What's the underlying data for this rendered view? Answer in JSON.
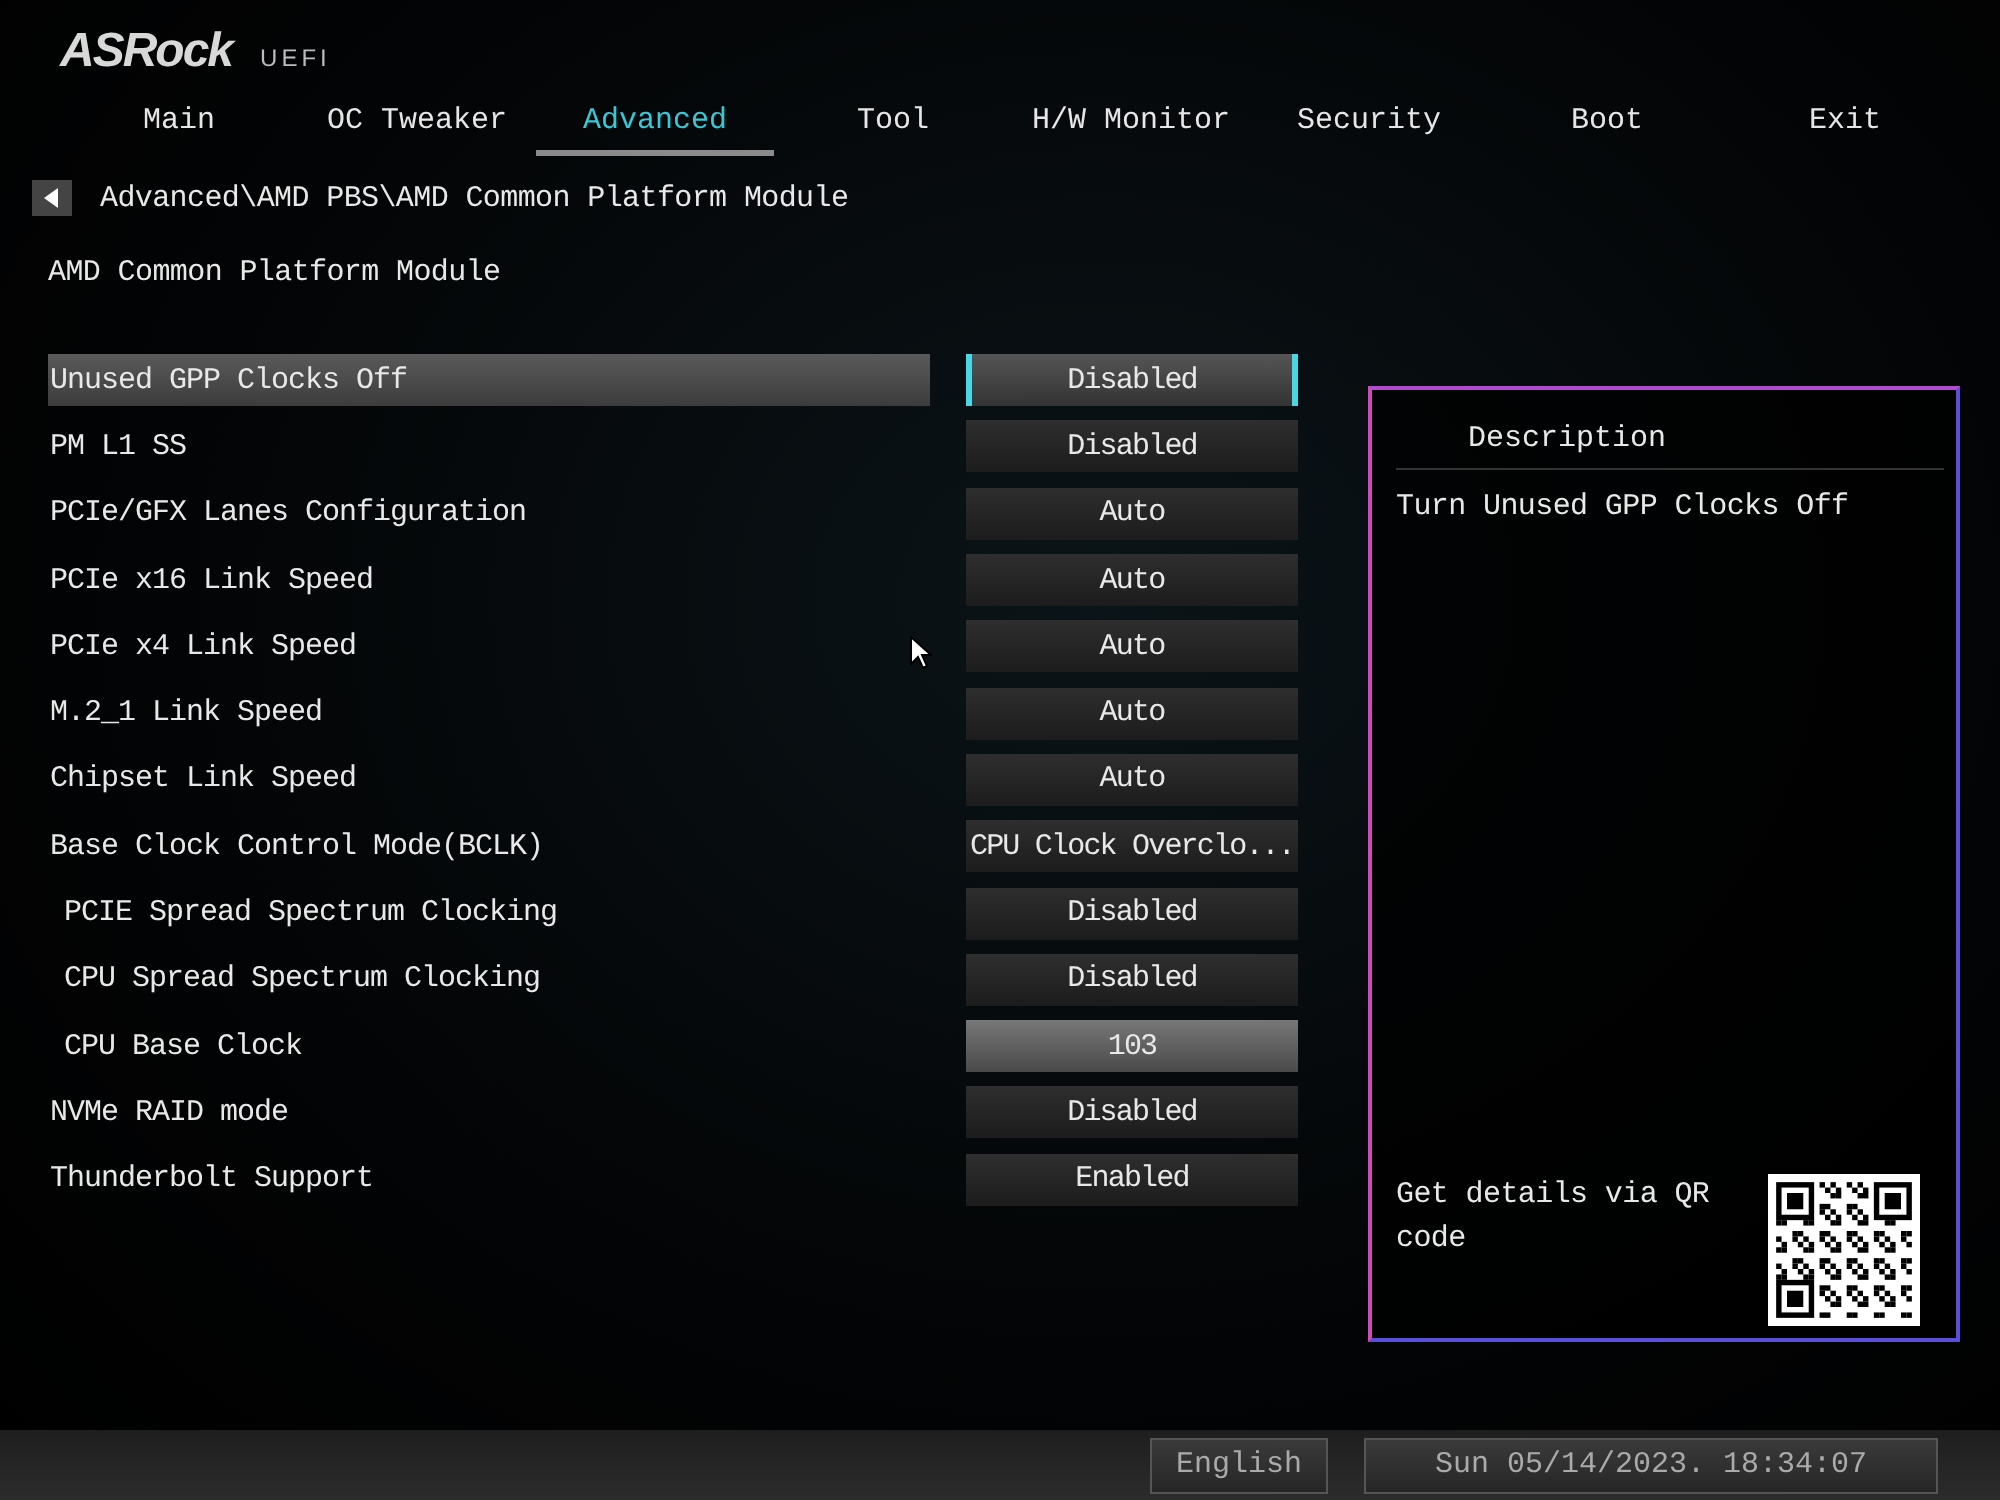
{
  "logo": {
    "brand": "ASRock",
    "product": "UEFI"
  },
  "tabs": [
    {
      "label": "Main",
      "selected": false
    },
    {
      "label": "OC Tweaker",
      "selected": false
    },
    {
      "label": "Advanced",
      "selected": true
    },
    {
      "label": "Tool",
      "selected": false
    },
    {
      "label": "H/W Monitor",
      "selected": false
    },
    {
      "label": "Security",
      "selected": false
    },
    {
      "label": "Boot",
      "selected": false
    },
    {
      "label": "Exit",
      "selected": false
    }
  ],
  "breadcrumb": "Advanced\\AMD PBS\\AMD Common Platform Module",
  "page_title": "AMD Common Platform Module",
  "settings": [
    {
      "label": "Unused GPP Clocks Off",
      "value": "Disabled",
      "kind": "option",
      "selected": true
    },
    {
      "label": "PM L1 SS",
      "value": "Disabled",
      "kind": "option",
      "selected": false
    },
    {
      "label": "PCIe/GFX Lanes Configuration",
      "value": "Auto",
      "kind": "option",
      "selected": false
    },
    {
      "label": "PCIe x16 Link Speed",
      "value": "Auto",
      "kind": "option",
      "selected": false
    },
    {
      "label": "PCIe x4 Link Speed",
      "value": "Auto",
      "kind": "option",
      "selected": false
    },
    {
      "label": "M.2_1 Link Speed",
      "value": "Auto",
      "kind": "option",
      "selected": false
    },
    {
      "label": "Chipset Link Speed",
      "value": "Auto",
      "kind": "option",
      "selected": false
    },
    {
      "label": "Base Clock Control Mode(BCLK)",
      "value": "CPU Clock Overclo...",
      "kind": "option",
      "selected": false,
      "children": [
        {
          "label": "PCIE Spread Spectrum Clocking",
          "value": "Disabled",
          "kind": "option",
          "selected": false
        },
        {
          "label": "CPU Spread Spectrum Clocking",
          "value": "Disabled",
          "kind": "option",
          "selected": false
        },
        {
          "label": "CPU Base Clock",
          "value": "103",
          "kind": "number",
          "selected": false
        }
      ]
    },
    {
      "label": "NVMe RAID mode",
      "value": "Disabled",
      "kind": "option",
      "selected": false
    },
    {
      "label": "Thunderbolt Support",
      "value": "Enabled",
      "kind": "option",
      "selected": false
    }
  ],
  "description": {
    "title": "Description",
    "text": "Turn Unused GPP Clocks Off",
    "qr_text": "Get details via QR code"
  },
  "status_bar": {
    "language": "English",
    "datetime": "Sun 05/14/2023. 18:34:07"
  }
}
